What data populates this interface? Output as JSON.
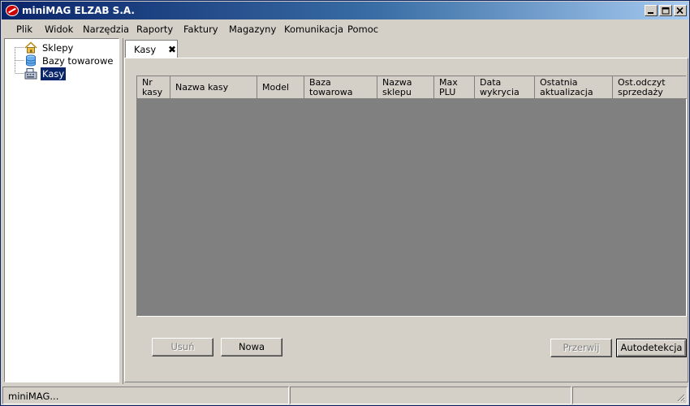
{
  "window": {
    "title": "miniMAG ELZAB S.A."
  },
  "menu": [
    "Plik",
    "Widok",
    "Narzędzia",
    "Raporty",
    "Faktury",
    "Magazyny",
    "Komunikacja",
    "Pomoc"
  ],
  "tree": {
    "items": [
      {
        "label": "Sklepy",
        "icon": "home-icon"
      },
      {
        "label": "Bazy towarowe",
        "icon": "database-icon"
      },
      {
        "label": "Kasy",
        "icon": "cash-register-icon",
        "selected": true
      }
    ]
  },
  "tab": {
    "label": "Kasy",
    "close": "✖"
  },
  "table": {
    "columns": [
      "Nr\nkasy",
      "Nazwa kasy",
      "Model",
      "Baza\ntowarowa",
      "Nazwa\nsklepu",
      "Max\nPLU",
      "Data\nwykrycia",
      "Ostatnia\naktualizacja",
      "Ost.odczyt\nsprzedaży"
    ],
    "rows": []
  },
  "buttons": {
    "delete": "Usuń",
    "new": "Nowa",
    "interrupt": "Przerwij",
    "autodetect": "Autodetekcja"
  },
  "status": {
    "text": "miniMAG..."
  }
}
